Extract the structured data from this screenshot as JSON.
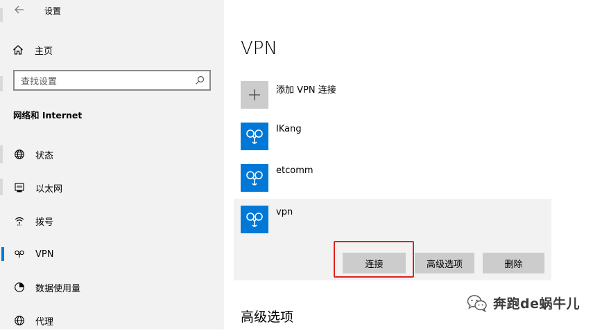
{
  "window": {
    "title": "设置"
  },
  "sidebar": {
    "home_label": "主页",
    "search_placeholder": "查找设置",
    "section_title": "网络和 Internet",
    "items": [
      {
        "label": "状态",
        "icon": "globe-icon",
        "selected": false
      },
      {
        "label": "以太网",
        "icon": "ethernet-icon",
        "selected": false
      },
      {
        "label": "拨号",
        "icon": "dialup-icon",
        "selected": false
      },
      {
        "label": "VPN",
        "icon": "vpn-icon",
        "selected": true
      },
      {
        "label": "数据使用量",
        "icon": "data-usage-icon",
        "selected": false
      },
      {
        "label": "代理",
        "icon": "proxy-globe-icon",
        "selected": false
      }
    ]
  },
  "main": {
    "title": "VPN",
    "add_label": "添加 VPN 连接",
    "connections": [
      {
        "name": "IKang"
      },
      {
        "name": "etcomm"
      },
      {
        "name": "vpn"
      }
    ],
    "buttons": {
      "connect": "连接",
      "advanced": "高级选项",
      "delete": "删除"
    },
    "section2_title": "高级选项"
  },
  "watermark": {
    "text": "奔跑de蜗牛儿"
  },
  "colors": {
    "accent": "#0078d7",
    "sidebar_bg": "#f2f2f2",
    "highlight": "#e0201f",
    "button_bg": "#cccccc"
  }
}
